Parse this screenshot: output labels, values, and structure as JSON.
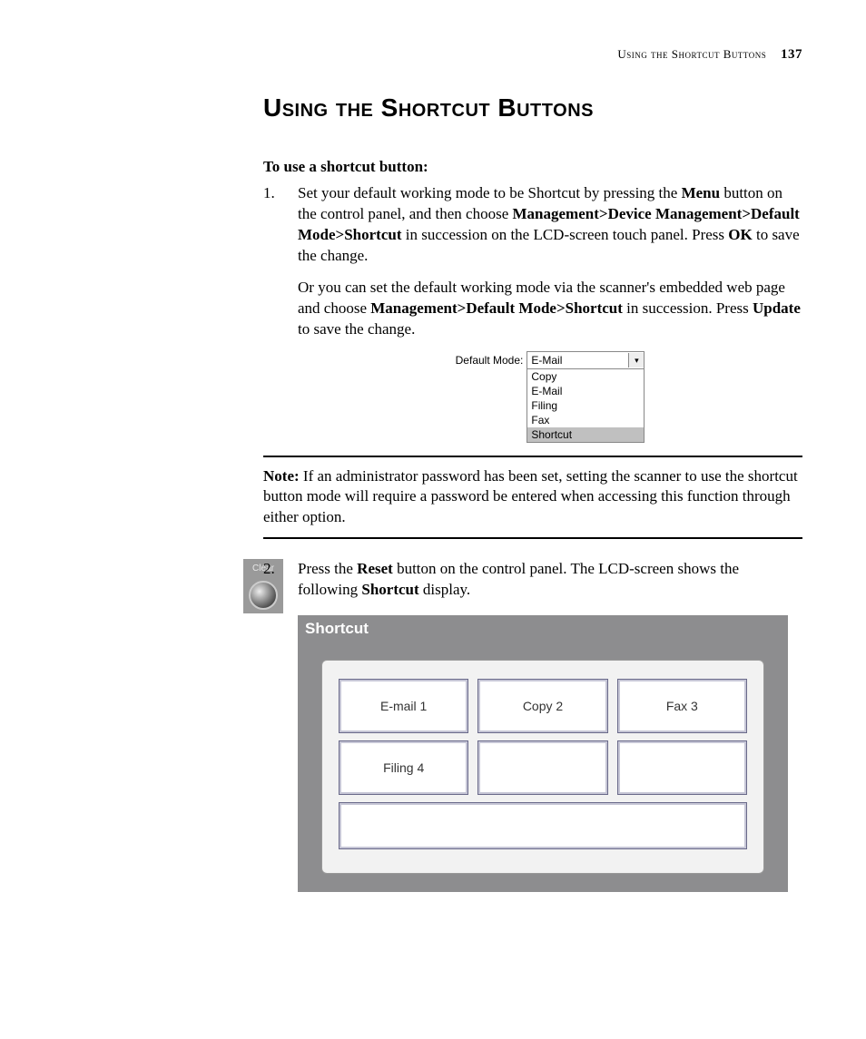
{
  "header": {
    "running_title": "Using the Shortcut Buttons",
    "page_number": "137"
  },
  "title": "Using the Shortcut Buttons",
  "intro": "To use a shortcut button:",
  "step1": {
    "num": "1.",
    "p1_a": "Set your default working mode to be Shortcut by pressing the ",
    "p1_menu": "Menu",
    "p1_b": " button on the control panel, and then choose ",
    "p1_path1": "Management>Device Management>Default Mode>Shortcut",
    "p1_c": " in succession on the LCD-screen touch panel. Press ",
    "p1_ok": "OK",
    "p1_d": " to save the change.",
    "p2_a": "Or you can set the default working mode via the scanner's embedded web page and choose ",
    "p2_path": "Management>Default Mode>Shortcut",
    "p2_b": " in succession. Press ",
    "p2_update": "Update",
    "p2_c": " to save the change."
  },
  "dropdown": {
    "label": "Default Mode:",
    "selected": "E-Mail",
    "options": [
      "Copy",
      "E-Mail",
      "Filing",
      "Fax",
      "Shortcut"
    ],
    "highlighted": "Shortcut"
  },
  "note": {
    "label": "Note:",
    "text": " If an administrator password has been set, setting the scanner to use the shortcut button mode will require a password be entered when accessing this function through either option."
  },
  "step2": {
    "num": "2.",
    "a": "Press the ",
    "reset": "Reset",
    "b": " button on the control panel. The LCD-screen shows the following ",
    "shortcut": "Shortcut",
    "c": " display."
  },
  "clear_button_label": "Clear",
  "lcd": {
    "title": "Shortcut",
    "buttons": [
      "E-mail 1",
      "Copy 2",
      "Fax 3",
      "Filing 4",
      "",
      ""
    ]
  }
}
